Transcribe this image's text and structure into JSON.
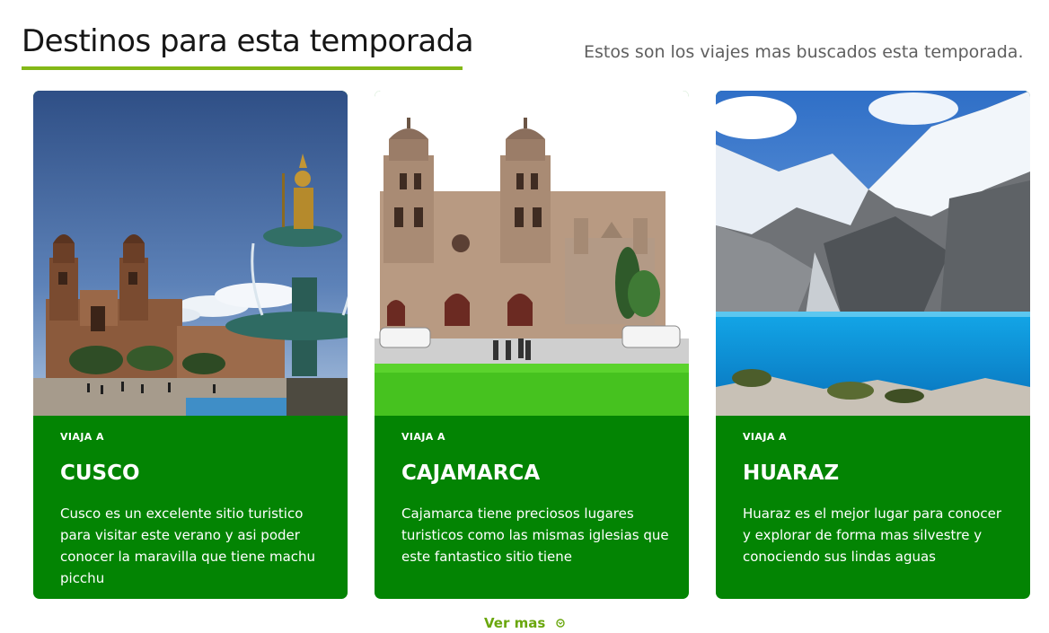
{
  "section": {
    "title": "Destinos para esta temporada",
    "subtitle": "Estos son los viajes mas buscados esta temporada."
  },
  "cards": [
    {
      "kicker": "VIAJA A",
      "title": "CUSCO",
      "description": "Cusco es un excelente sitio turistico para visitar este verano y asi poder conocer la maravilla que tiene machu picchu"
    },
    {
      "kicker": "VIAJA A",
      "title": "CAJAMARCA",
      "description": "Cajamarca tiene preciosos lugares turisticos como las mismas iglesias que este fantastico sitio tiene"
    },
    {
      "kicker": "VIAJA A",
      "title": "HUARAZ",
      "description": "Huaraz es el mejor lugar para conocer y explorar de forma mas silvestre y conociendo sus lindas aguas"
    }
  ],
  "more_link": {
    "label": "Ver mas",
    "icon": "chevron-down-circle-icon"
  },
  "colors": {
    "accent": "#84b817",
    "card_background": "#038403",
    "link": "#6aa70e"
  }
}
